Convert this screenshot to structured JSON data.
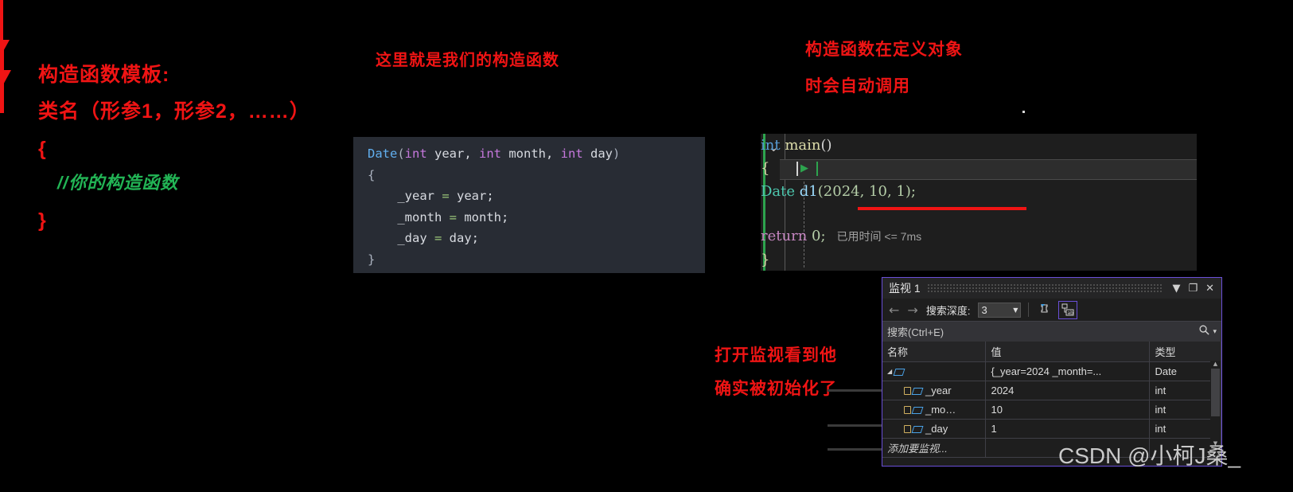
{
  "annotations": {
    "template_title": "构造函数模板:",
    "template_signature": "类名（形参1，形参2，……）",
    "template_open_brace": "{",
    "template_comment": "//你的构造函数",
    "template_close_brace": "}",
    "this_is_constructor": "这里就是我们的构造函数",
    "auto_call_line1": "构造函数在定义对象",
    "auto_call_line2": "时会自动调用",
    "watch_note_line1": "打开监视看到他",
    "watch_note_line2": "确实被初始化了"
  },
  "code_left": {
    "line1": {
      "cls": "Date",
      "p1": "(",
      "kw1": "int",
      "v1": " year, ",
      "kw2": "int",
      "v2": " month, ",
      "kw3": "int",
      "v3": " day",
      "p2": ")"
    },
    "line2": "{",
    "line3": {
      "lhs": "_year",
      "op": " = ",
      "rhs": "year;"
    },
    "line4": {
      "lhs": "_month",
      "op": " = ",
      "rhs": "month;"
    },
    "line5": {
      "lhs": "_day",
      "op": " = ",
      "rhs": "day;"
    },
    "line6": "}"
  },
  "code_right": {
    "chevron": "⌄",
    "main_type": "int",
    "main_name": " main",
    "main_parens": "()",
    "open_brace": "{",
    "run_arrow": "▶",
    "date_type": "Date",
    "date_var": " d1",
    "date_args": "(2024, 10, 1);",
    "return_kw": "return",
    "return_val": " 0;",
    "elapsed_time": "已用时间 <= 7ms",
    "close_brace": "}"
  },
  "watch_window": {
    "title": "监视 1",
    "dropdown_btn": "▼",
    "maximize_btn": "❐",
    "close_btn": "✕",
    "back_arrow": "←",
    "forward_arrow": "→",
    "depth_label": "搜索深度:",
    "depth_value": "3",
    "depth_caret": "▼",
    "search_placeholder": "搜索(Ctrl+E)",
    "search_icon": "🔍",
    "search_caret": "▾",
    "columns": [
      "名称",
      "值",
      "类型"
    ],
    "rows": [
      {
        "name": "",
        "value": "{_year=2024 _month=...",
        "type": "Date",
        "expanded": true,
        "indent": 0
      },
      {
        "name": "_year",
        "value": "2024",
        "type": "int",
        "expanded": false,
        "indent": 1
      },
      {
        "name": "_mo…",
        "value": "10",
        "type": "int",
        "expanded": false,
        "indent": 1
      },
      {
        "name": "_day",
        "value": "1",
        "type": "int",
        "expanded": false,
        "indent": 1
      }
    ],
    "add_watch_row": "添加要监视..."
  },
  "watermark": "CSDN @小柯J桑_",
  "colors": {
    "annotation_red": "#f01414",
    "annotation_green": "#22b455",
    "accent_purple": "#6a4fd8",
    "background": "#000000"
  }
}
